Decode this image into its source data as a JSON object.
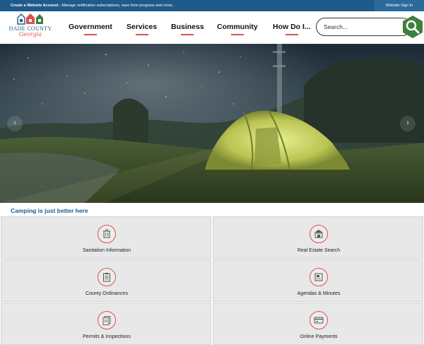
{
  "topbar": {
    "account_bold": "Create a Website Account",
    "account_text": " - Manage notification subscriptions, save form progress and more.",
    "signin": "Website Sign In"
  },
  "logo": {
    "line1": "DADE COUNTY",
    "line2": "Georgia"
  },
  "nav": {
    "items": [
      "Government",
      "Services",
      "Business",
      "Community",
      "How Do I..."
    ]
  },
  "search": {
    "placeholder": "Search..."
  },
  "hero": {
    "caption": "Camping is just better here"
  },
  "tiles": [
    {
      "label": "Sanitation Information",
      "icon": "trash-can-icon"
    },
    {
      "label": "Real Estate Search",
      "icon": "building-icon"
    },
    {
      "label": "County Ordinances",
      "icon": "clipboard-icon"
    },
    {
      "label": "Agendas & Minutes",
      "icon": "document-icon"
    },
    {
      "label": "Permits & Inspections",
      "icon": "papers-icon"
    },
    {
      "label": "Online Payments",
      "icon": "credit-card-icon"
    }
  ],
  "colors": {
    "brand_blue": "#1e5b8a",
    "accent_red": "#d9534f",
    "search_green": "#3f7f3f"
  }
}
